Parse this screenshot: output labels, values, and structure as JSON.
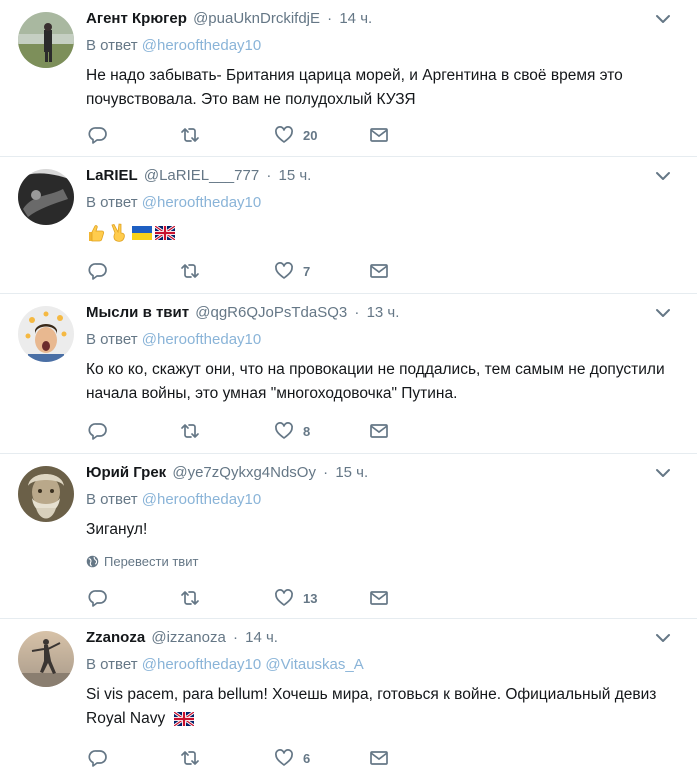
{
  "tweets": [
    {
      "name": "Агент Крюгер",
      "handle": "@puaUknDrckifdjE",
      "time": "14 ч.",
      "reply_prefix": "В ответ",
      "mentions": "@herooftheday10",
      "text": "Не надо забывать- Британия царица морей, и Аргентина в своё время это почувствовала. Это вам не полудохлый КУЗЯ",
      "likes": "20"
    },
    {
      "name": "LaRIEL",
      "handle": "@LaRIEL___777",
      "time": "15 ч.",
      "reply_prefix": "В ответ",
      "mentions": "@herooftheday10",
      "text": "",
      "emojis": [
        "thumbs-up",
        "victory-hand",
        "flag-ukraine",
        "flag-uk"
      ],
      "likes": "7"
    },
    {
      "name": "Мысли в твит",
      "handle": "@qgR6QJoPsTdaSQ3",
      "time": "13 ч.",
      "reply_prefix": "В ответ",
      "mentions": "@herooftheday10",
      "text": "Ко ко ко, скажут они, что на провокации не поддались, тем самым не допустили начала войны, это умная \"многоходовочка\" Путина.",
      "likes": "8"
    },
    {
      "name": "Юрий Грек",
      "handle": "@ye7zQykxg4NdsOy",
      "time": "15 ч.",
      "reply_prefix": "В ответ",
      "mentions": "@herooftheday10",
      "text": "Зиганул!",
      "translate": "Перевести твит",
      "likes": "13"
    },
    {
      "name": "Zzanoza",
      "handle": "@izzanoza",
      "time": "14 ч.",
      "reply_prefix": "В ответ",
      "mentions": "@herooftheday10 @Vitauskas_A",
      "text": "Si vis pacem, para bellum! Хочешь мира, готовься к войне. Официальный девиз Royal Navy",
      "likes": "6"
    }
  ],
  "separator": "·",
  "icons": {
    "reply": "reply-icon",
    "retweet": "retweet-icon",
    "like": "heart-icon",
    "dm": "envelope-icon",
    "menu": "chevron-down-icon",
    "globe": "globe-icon"
  },
  "colors": {
    "icon_gray": "#657786",
    "mention_blue": "#8ab4d8",
    "divider": "#e6ecf0"
  }
}
